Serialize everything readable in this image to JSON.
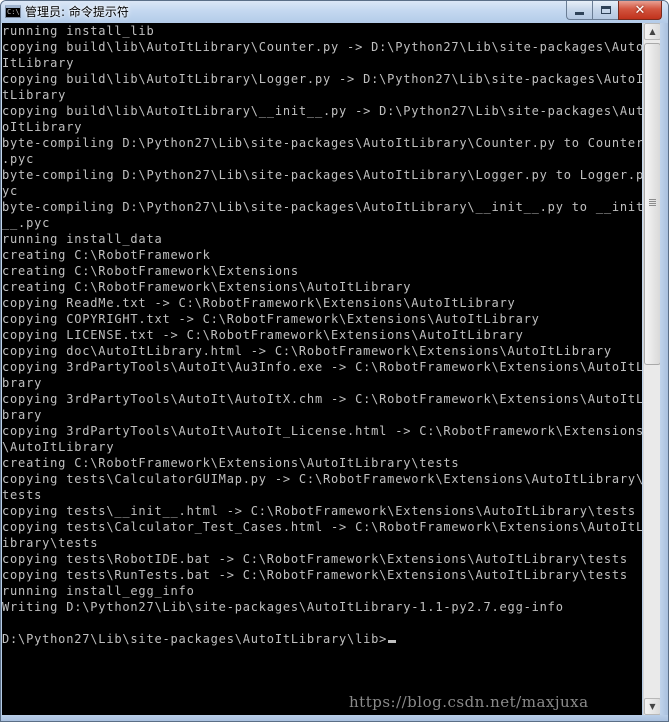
{
  "window": {
    "title": "管理员: 命令提示符",
    "icon_text": "C:\\"
  },
  "console": {
    "lines": [
      "running install_lib",
      "copying build\\lib\\AutoItLibrary\\Counter.py -> D:\\Python27\\Lib\\site-packages\\Auto",
      "ItLibrary",
      "copying build\\lib\\AutoItLibrary\\Logger.py -> D:\\Python27\\Lib\\site-packages\\AutoI",
      "tLibrary",
      "copying build\\lib\\AutoItLibrary\\__init__.py -> D:\\Python27\\Lib\\site-packages\\Aut",
      "oItLibrary",
      "byte-compiling D:\\Python27\\Lib\\site-packages\\AutoItLibrary\\Counter.py to Counter",
      ".pyc",
      "byte-compiling D:\\Python27\\Lib\\site-packages\\AutoItLibrary\\Logger.py to Logger.p",
      "yc",
      "byte-compiling D:\\Python27\\Lib\\site-packages\\AutoItLibrary\\__init__.py to __init",
      "__.pyc",
      "running install_data",
      "creating C:\\RobotFramework",
      "creating C:\\RobotFramework\\Extensions",
      "creating C:\\RobotFramework\\Extensions\\AutoItLibrary",
      "copying ReadMe.txt -> C:\\RobotFramework\\Extensions\\AutoItLibrary",
      "copying COPYRIGHT.txt -> C:\\RobotFramework\\Extensions\\AutoItLibrary",
      "copying LICENSE.txt -> C:\\RobotFramework\\Extensions\\AutoItLibrary",
      "copying doc\\AutoItLibrary.html -> C:\\RobotFramework\\Extensions\\AutoItLibrary",
      "copying 3rdPartyTools\\AutoIt\\Au3Info.exe -> C:\\RobotFramework\\Extensions\\AutoItLi",
      "brary",
      "copying 3rdPartyTools\\AutoIt\\AutoItX.chm -> C:\\RobotFramework\\Extensions\\AutoItLi",
      "brary",
      "copying 3rdPartyTools\\AutoIt\\AutoIt_License.html -> C:\\RobotFramework\\Extensions",
      "\\AutoItLibrary",
      "creating C:\\RobotFramework\\Extensions\\AutoItLibrary\\tests",
      "copying tests\\CalculatorGUIMap.py -> C:\\RobotFramework\\Extensions\\AutoItLibrary\\",
      "tests",
      "copying tests\\__init__.html -> C:\\RobotFramework\\Extensions\\AutoItLibrary\\tests",
      "copying tests\\Calculator_Test_Cases.html -> C:\\RobotFramework\\Extensions\\AutoItL",
      "ibrary\\tests",
      "copying tests\\RobotIDE.bat -> C:\\RobotFramework\\Extensions\\AutoItLibrary\\tests",
      "copying tests\\RunTests.bat -> C:\\RobotFramework\\Extensions\\AutoItLibrary\\tests",
      "running install_egg_info",
      "Writing D:\\Python27\\Lib\\site-packages\\AutoItLibrary-1.1-py2.7.egg-info",
      "",
      "D:\\Python27\\Lib\\site-packages\\AutoItLibrary\\lib>"
    ]
  },
  "watermark": "https://blog.csdn.net/maxjuxa",
  "colors": {
    "console_bg": "#000000",
    "console_fg": "#c0c0c0",
    "close_button": "#c0321c"
  }
}
